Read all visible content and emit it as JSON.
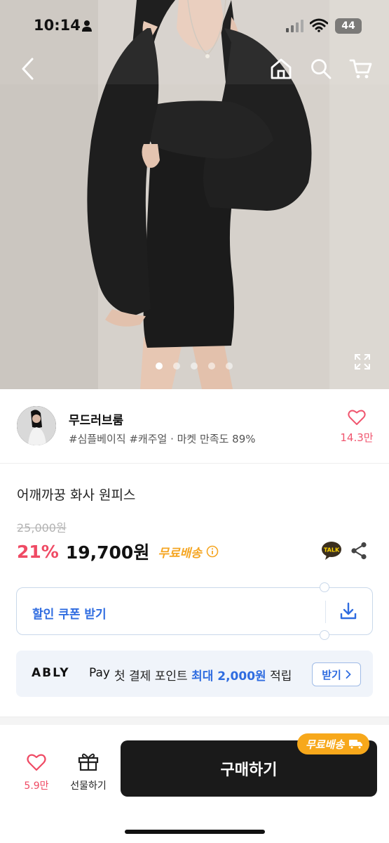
{
  "status_bar": {
    "time": "10:14",
    "battery": "44"
  },
  "nav": {
    "back_icon": "chevron-left-icon",
    "home_icon": "home-icon",
    "search_icon": "search-icon",
    "cart_icon": "cart-icon"
  },
  "gallery": {
    "image_count": 5,
    "active_index": 0
  },
  "seller": {
    "name": "무드러브룸",
    "tags": "#심플베이직 #캐주얼 · 마켓 만족도 89%",
    "favorite_count": "14.3만"
  },
  "product": {
    "name": "어깨까꿍 화사 원피스",
    "original_price": "25,000원",
    "discount": "21%",
    "price": "19,700원",
    "shipping": "무료배송"
  },
  "coupon": {
    "label": "할인 쿠폰 받기"
  },
  "ably_pay": {
    "brand": "ABLY",
    "pay": "Pay",
    "message_prefix": "첫 결제 포인트",
    "message_highlight": "최대 2,000원",
    "message_suffix": "적립",
    "button": "받기"
  },
  "bottom_bar": {
    "like_count": "5.9만",
    "gift_label": "선물하기",
    "buy_label": "구매하기",
    "free_shipping_badge": "무료배송"
  },
  "colors": {
    "accent_red": "#ef4a64",
    "accent_blue": "#2f6ce0",
    "accent_orange": "#f5a623",
    "buy_button": "#1a1a1a"
  }
}
